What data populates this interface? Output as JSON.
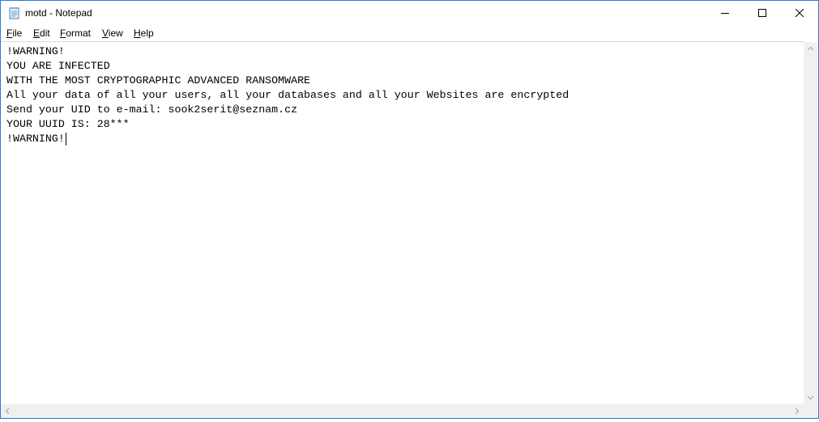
{
  "window": {
    "title": "motd - Notepad"
  },
  "controls": {
    "minimize_icon": "minimize-icon",
    "maximize_icon": "maximize-icon",
    "close_icon": "close-icon"
  },
  "menu": {
    "items": [
      {
        "accel": "F",
        "rest": "ile"
      },
      {
        "accel": "E",
        "rest": "dit"
      },
      {
        "accel": "F",
        "rest": "ormat",
        "prefix": ""
      },
      {
        "accel": "V",
        "rest": "iew"
      },
      {
        "accel": "H",
        "rest": "elp"
      }
    ]
  },
  "document": {
    "lines": [
      "!WARNING!",
      "YOU ARE INFECTED",
      "WITH THE MOST CRYPTOGRAPHIC ADVANCED RANSOMWARE",
      "All your data of all your users, all your databases and all your Websites are encrypted",
      "Send your UID to e-mail: sook2serit@seznam.cz",
      "YOUR UUID IS: 28***",
      "!WARNING!"
    ]
  },
  "colors": {
    "window_border": "#2b79d8",
    "scrollbar": "#f0f0f0",
    "text": "#000000"
  }
}
